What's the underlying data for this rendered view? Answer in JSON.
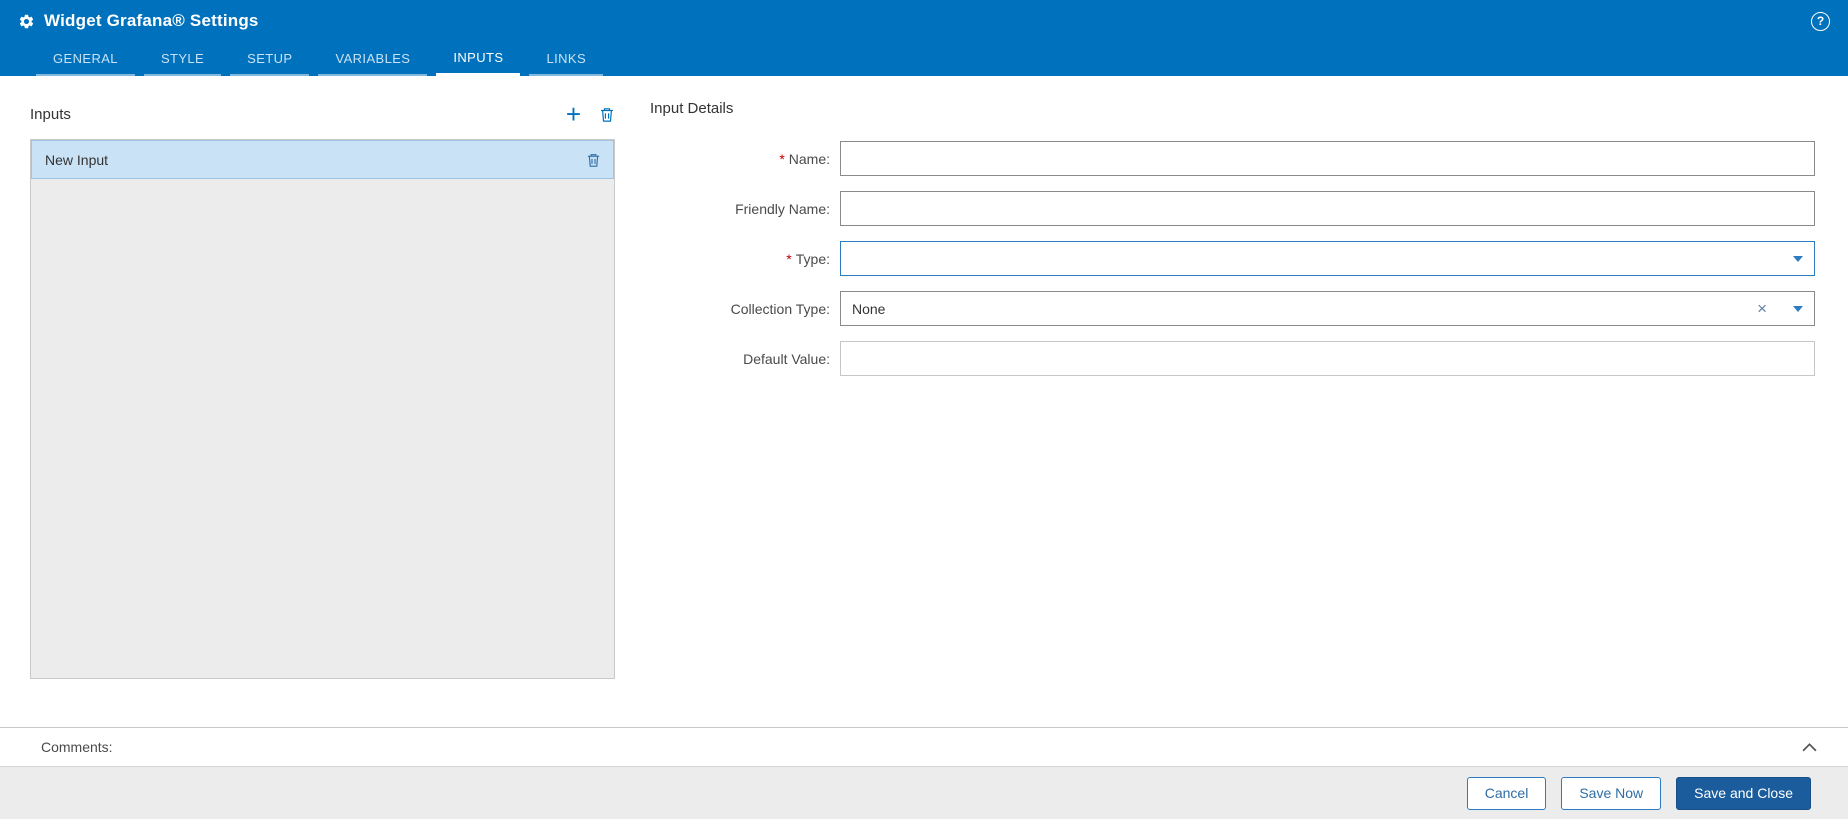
{
  "header": {
    "title": "Widget Grafana® Settings",
    "help_glyph": "?",
    "tabs": [
      {
        "label": "GENERAL",
        "active": false
      },
      {
        "label": "STYLE",
        "active": false
      },
      {
        "label": "SETUP",
        "active": false
      },
      {
        "label": "VARIABLES",
        "active": false
      },
      {
        "label": "INPUTS",
        "active": true
      },
      {
        "label": "LINKS",
        "active": false
      }
    ]
  },
  "inputs_panel": {
    "title": "Inputs",
    "add_glyph": "+",
    "items": [
      {
        "label": "New Input",
        "selected": true
      }
    ]
  },
  "details": {
    "title": "Input Details",
    "required_marker": "*",
    "fields": {
      "name": {
        "label": "Name:",
        "required": true,
        "value": ""
      },
      "friendly_name": {
        "label": "Friendly Name:",
        "required": false,
        "value": ""
      },
      "type": {
        "label": "Type:",
        "required": true,
        "value": ""
      },
      "collection_type": {
        "label": "Collection Type:",
        "required": false,
        "value": "None",
        "clear_glyph": "×"
      },
      "default_value": {
        "label": "Default Value:",
        "required": false,
        "value": ""
      }
    }
  },
  "comments": {
    "label": "Comments:"
  },
  "footer": {
    "cancel_label": "Cancel",
    "save_now_label": "Save Now",
    "save_and_close_label": "Save and Close"
  },
  "colors": {
    "header_blue": "#0071bc",
    "accent_blue": "#2e7cc0",
    "primary_button": "#1a5c9c",
    "selected_item_bg": "#c9e2f6",
    "required_red": "#c00000"
  },
  "icons": {
    "gear": "settings-gear",
    "help": "question-circle",
    "add": "plus",
    "delete": "trash",
    "clear": "x",
    "dropdown": "caret-down",
    "collapse": "chevron-up"
  }
}
